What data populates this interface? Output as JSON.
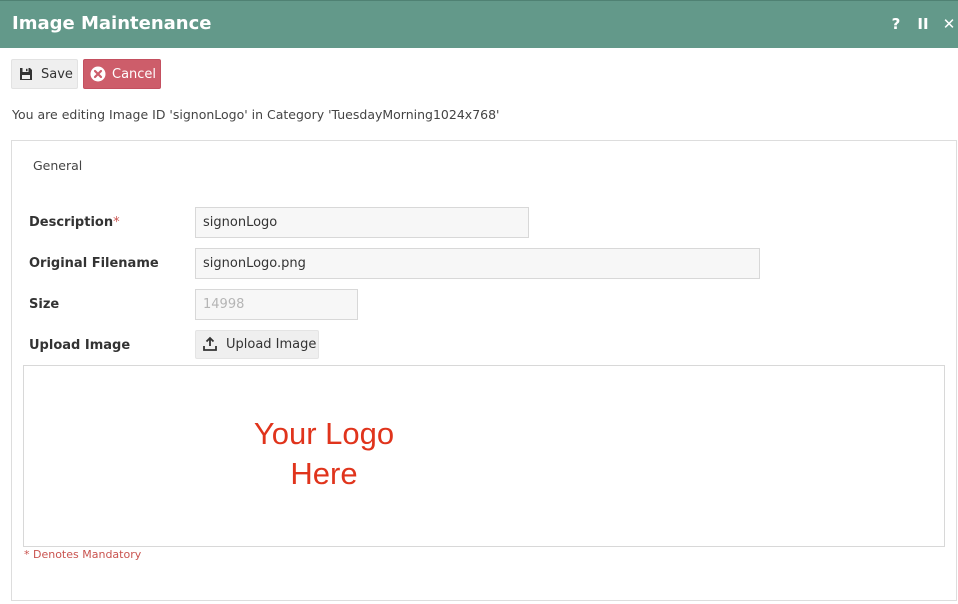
{
  "window": {
    "title": "Image Maintenance",
    "controls": {
      "help": "?",
      "pause": "II",
      "close": "✕"
    }
  },
  "toolbar": {
    "save_label": "Save",
    "cancel_label": "Cancel"
  },
  "info_text": "You are editing Image ID 'signonLogo' in Category 'TuesdayMorning1024x768'",
  "section": {
    "title": "General"
  },
  "form": {
    "description": {
      "label": "Description",
      "required_mark": "*",
      "value": "signonLogo"
    },
    "original_filename": {
      "label": "Original Filename",
      "value": "signonLogo.png"
    },
    "size": {
      "label": "Size",
      "value": "14998"
    },
    "upload": {
      "label": "Upload Image",
      "button_label": "Upload Image"
    }
  },
  "preview": {
    "line1": "Your Logo",
    "line2": "Here",
    "color": "#e0341c"
  },
  "footer": {
    "mandatory_note": "* Denotes Mandatory"
  },
  "colors": {
    "titlebar": "#63998a",
    "cancel": "#cd5d6a",
    "required": "#c9534f"
  }
}
